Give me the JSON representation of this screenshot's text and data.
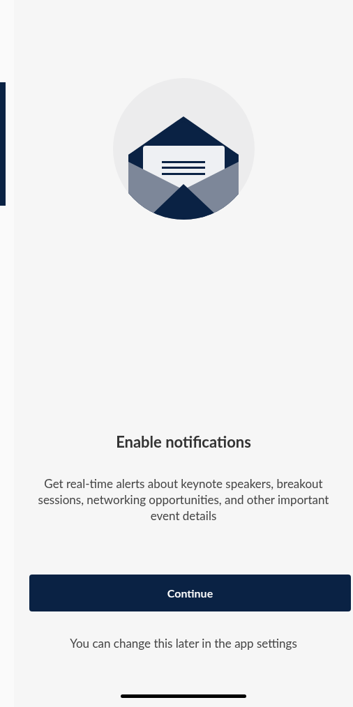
{
  "title": "Enable notifications",
  "description": "Get real-time alerts about keynote speakers, breakout sessions, networking opportunities, and other important event details",
  "button": "Continue",
  "footnote": "You can change this later in the app settings"
}
